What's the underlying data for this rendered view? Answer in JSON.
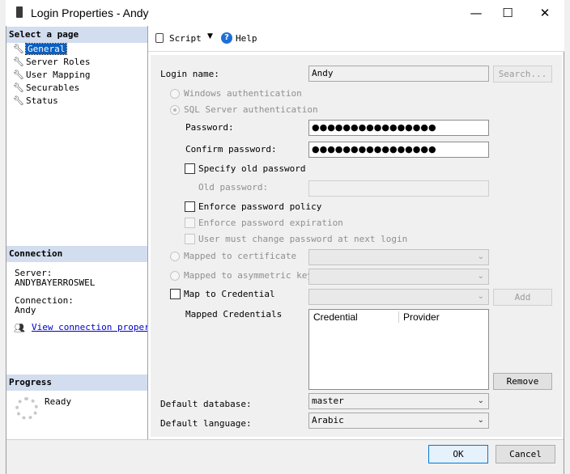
{
  "window": {
    "title": "Login Properties - Andy",
    "controls": {
      "minimize": "—",
      "maximize": "☐",
      "close": "✕"
    }
  },
  "left_pane": {
    "select_page_header": "Select a page",
    "pages": [
      {
        "label": "General",
        "selected": true
      },
      {
        "label": "Server Roles",
        "selected": false
      },
      {
        "label": "User Mapping",
        "selected": false
      },
      {
        "label": "Securables",
        "selected": false
      },
      {
        "label": "Status",
        "selected": false
      }
    ],
    "connection": {
      "header": "Connection",
      "server_label": "Server:",
      "server_value": "ANDYBAYERROSWEL",
      "connection_label": "Connection:",
      "connection_value": "Andy",
      "link": "View connection properti"
    },
    "progress": {
      "header": "Progress",
      "status": "Ready"
    }
  },
  "toolbar": {
    "script_label": "Script",
    "help_label": "Help"
  },
  "form": {
    "login_name_label": "Login name:",
    "login_name_value": "Andy",
    "search_button": "Search...",
    "windows_auth": "Windows authentication",
    "sql_auth": "SQL Server authentication",
    "password_label": "Password:",
    "password_value": "●●●●●●●●●●●●●●●●",
    "confirm_password_label": "Confirm password:",
    "confirm_password_value": "●●●●●●●●●●●●●●●●",
    "specify_old_password": "Specify old password",
    "old_password_label": "Old password:",
    "enforce_policy": "Enforce password policy",
    "enforce_expiration": "Enforce password expiration",
    "must_change": "User must change password at next login",
    "mapped_certificate": "Mapped to certificate",
    "mapped_asym_key": "Mapped to asymmetric key",
    "map_credential": "Map to Credential",
    "add_button": "Add",
    "mapped_credentials_label": "Mapped Credentials",
    "credentials_columns": [
      "Credential",
      "Provider"
    ],
    "remove_button": "Remove",
    "default_database_label": "Default database:",
    "default_database_value": "master",
    "default_language_label": "Default language:",
    "default_language_value": "Arabic"
  },
  "footer": {
    "ok_button": "OK",
    "cancel_button": "Cancel"
  },
  "colors": {
    "section_header": "#d2ddef",
    "selection": "#0a5fbf",
    "link": "#0000cc"
  }
}
